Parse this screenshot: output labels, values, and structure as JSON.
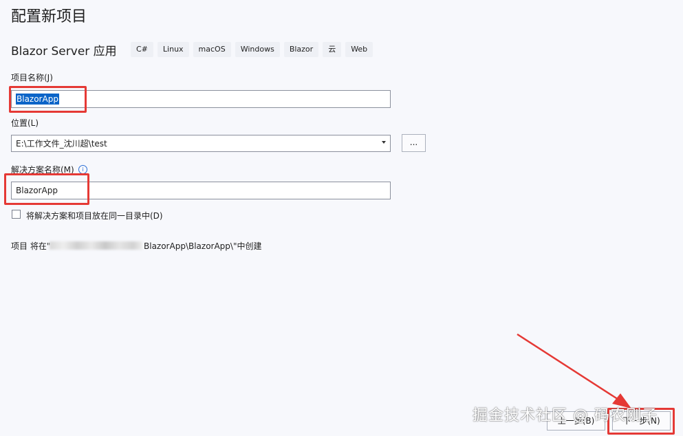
{
  "page_title": "配置新项目",
  "template_name": "Blazor Server 应用",
  "tags": [
    "C#",
    "Linux",
    "macOS",
    "Windows",
    "Blazor",
    "云",
    "Web"
  ],
  "project_name": {
    "label": "项目名称(J)",
    "value": "BlazorApp"
  },
  "location": {
    "label": "位置(L)",
    "value": "E:\\工作文件_沈川超\\test",
    "browse_label": "..."
  },
  "solution_name": {
    "label": "解决方案名称(M)",
    "value": "BlazorApp",
    "info_icon": "info-icon"
  },
  "same_dir_checkbox": {
    "label": "将解决方案和项目放在同一目录中(D)",
    "checked": false
  },
  "creation_path": {
    "prefix": "项目 将在\"",
    "suffix": "BlazorApp\\BlazorApp\\\"中创建"
  },
  "footer": {
    "back_label": "上一步(B)",
    "next_label": "下一步(N)"
  },
  "watermark": "掘金技术社区 @ 码农刚子",
  "colors": {
    "highlight_red": "#e53935",
    "selection_blue": "#0a64c8",
    "background": "#f7f8fc"
  }
}
